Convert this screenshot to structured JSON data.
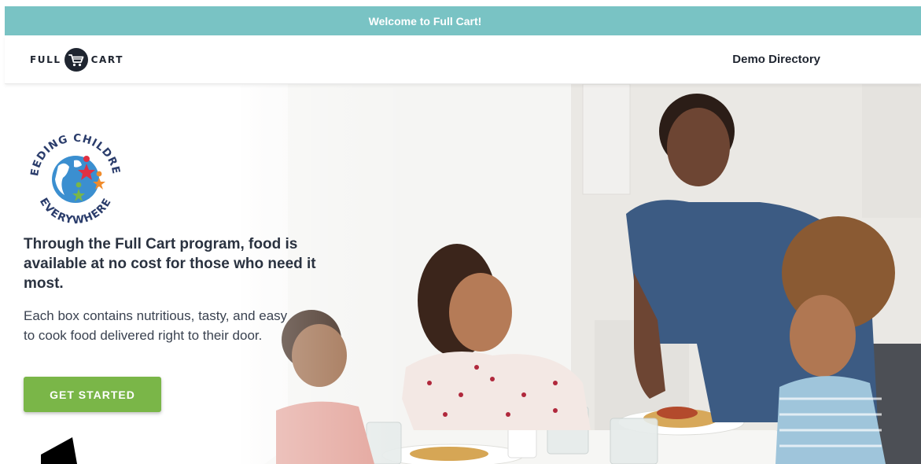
{
  "banner": {
    "text": "Welcome to Full Cart!"
  },
  "header": {
    "logo": {
      "word_left": "FULL",
      "word_right": "CART",
      "icon": "shopping-cart-icon"
    },
    "nav_link": "Demo Directory"
  },
  "hero": {
    "badge": {
      "text_top": "FEEDING CHILDREN",
      "text_bottom": "EVERYWHERE",
      "icon": "globe-stars-icon"
    },
    "headline": "Through the Full Cart program, food is available at no cost for those who need it most.",
    "body": "Each box contains nutritious, tasty, and easy to cook food delivered right to their door.",
    "cta_label": "GET STARTED"
  },
  "colors": {
    "banner": "#79c3c4",
    "cta": "#7ab648",
    "text": "#2b3340"
  }
}
